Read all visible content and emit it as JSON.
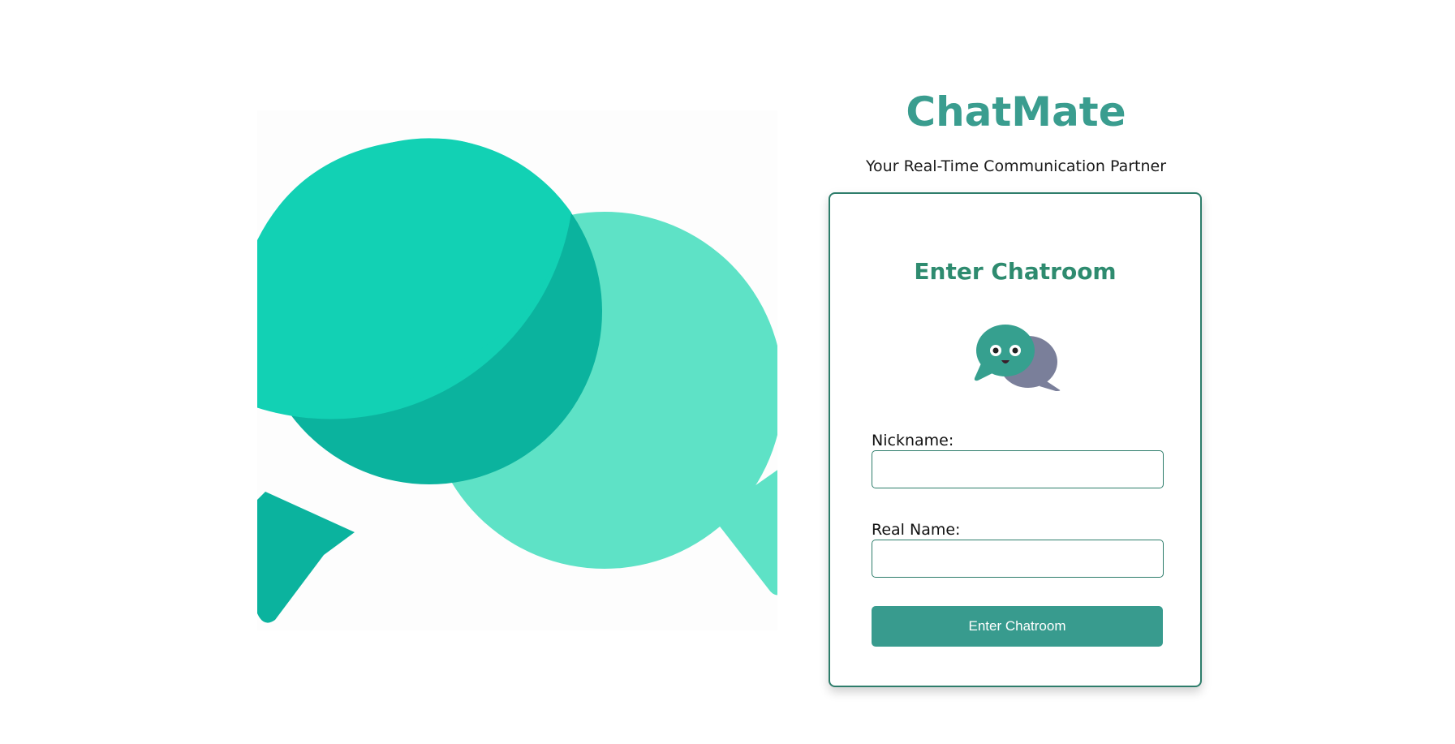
{
  "brand": {
    "title": "ChatMate",
    "tagline": "Your Real-Time Communication Partner"
  },
  "hero": {
    "icon": "chat-bubbles-illustration",
    "colors": {
      "bubble_front": "#12d1b4",
      "bubble_front_shade": "#0bb39e",
      "bubble_back": "#5ee2c6"
    }
  },
  "card": {
    "heading": "Enter Chatroom",
    "mascot_icon": "chat-mascot-icon",
    "fields": [
      {
        "label": "Nickname:",
        "value": "",
        "placeholder": ""
      },
      {
        "label": "Real Name:",
        "value": "",
        "placeholder": ""
      }
    ],
    "submit_label": "Enter Chatroom"
  },
  "colors": {
    "accent": "#3a9d8f",
    "heading": "#2e8b6f",
    "border": "#2e7d6b",
    "button": "#389b8e"
  }
}
